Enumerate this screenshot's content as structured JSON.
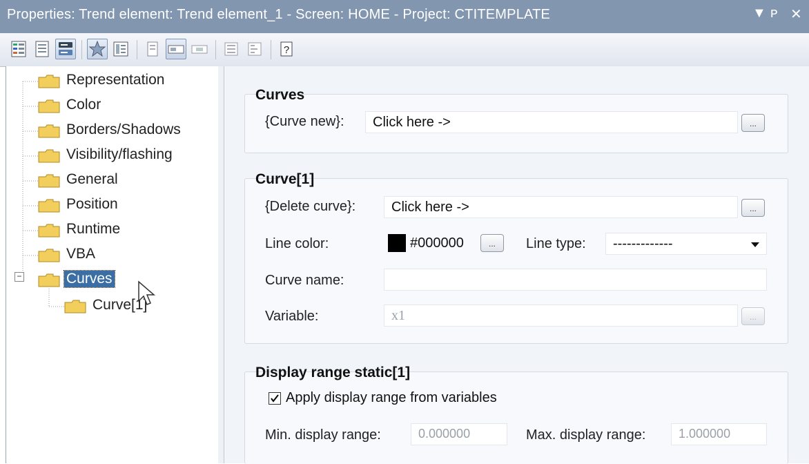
{
  "window": {
    "title": "Properties: Trend element: Trend element_1 - Screen: HOME - Project: CTITEMPLATE",
    "controls": [
      "▼",
      "ᴘ",
      "✕"
    ]
  },
  "toolbar": {
    "icons": [
      "sort-categorized-icon",
      "sort-alphabetical-icon",
      "property-view-icon",
      "favorites-icon",
      "properties-list-icon",
      "page-icon",
      "field-icon",
      "field-alt-icon",
      "expand-icon",
      "collapse-icon",
      "help-icon"
    ],
    "help_label": "?"
  },
  "tree": {
    "items": [
      {
        "label": "Representation"
      },
      {
        "label": "Color"
      },
      {
        "label": "Borders/Shadows"
      },
      {
        "label": "Visibility/flashing"
      },
      {
        "label": "General"
      },
      {
        "label": "Position"
      },
      {
        "label": "Runtime"
      },
      {
        "label": "VBA"
      },
      {
        "label": "Curves",
        "expander": "−"
      },
      {
        "label": "Curve[1]"
      }
    ],
    "selected": "Curves"
  },
  "curves": {
    "heading": "Curves",
    "new_label": "{Curve new}:",
    "new_value": "Click here ->",
    "ellipsis": "..."
  },
  "curve1": {
    "heading": "Curve[1]",
    "delete_label": "{Delete curve}:",
    "delete_value": "Click here ->",
    "line_color_label": "Line color:",
    "line_color_value": "#000000",
    "line_color_swatch": "#000000",
    "line_type_label": "Line type:",
    "line_type_value": "-------------",
    "curve_name_label": "Curve name:",
    "curve_name_value": "",
    "variable_label": "Variable:",
    "variable_value": "x1"
  },
  "display_range": {
    "heading": "Display range static[1]",
    "apply_checked": true,
    "apply_label": "Apply display range from variables",
    "min_label": "Min. display range:",
    "min_value": "0.000000",
    "max_label": "Max. display range:",
    "max_value": "1.000000"
  },
  "colors": {
    "titlebar": "#8296b0",
    "selection": "#3a6ea5",
    "folder": "#f2cf5c"
  }
}
